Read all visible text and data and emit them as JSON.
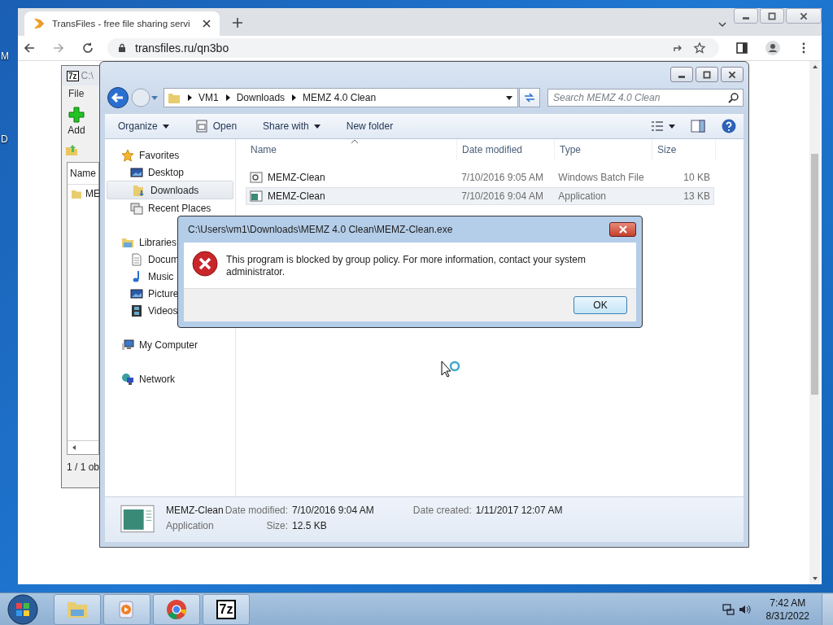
{
  "desktop": {
    "labels": [
      "M",
      "D"
    ]
  },
  "browser": {
    "tab_title": "TransFiles - free file sharing servi",
    "url": "transfiles.ru/qn3bo"
  },
  "archiver": {
    "logo": "7z",
    "title": "C:\\",
    "menu": [
      "File"
    ],
    "toolbar": [
      "Add"
    ],
    "column": "Name",
    "row": "ME",
    "status": "1 / 1 ob"
  },
  "explorer": {
    "breadcrumb": [
      "VM1",
      "Downloads",
      "MEMZ 4.0 Clean"
    ],
    "search": {
      "placeholder": "Search MEMZ 4.0 Clean"
    },
    "toolbar": [
      {
        "label": "Organize",
        "kind": "menu"
      },
      {
        "label": "Open",
        "kind": "open"
      },
      {
        "label": "Share with",
        "kind": "menu"
      },
      {
        "label": "New folder",
        "kind": "plain"
      }
    ],
    "nav": [
      {
        "label": "Favorites",
        "kind": "favorites",
        "selected": false,
        "children": [
          {
            "label": "Desktop",
            "kind": "screen",
            "selected": false
          },
          {
            "label": "Downloads",
            "kind": "folder",
            "selected": true
          },
          {
            "label": "Recent Places",
            "kind": "recent",
            "selected": false
          }
        ]
      },
      {
        "label": "Libraries",
        "kind": "folder",
        "selected": false,
        "children": [
          {
            "label": "Docum",
            "kind": "document",
            "selected": false
          },
          {
            "label": "Music",
            "kind": "music",
            "selected": false
          },
          {
            "label": "Picture",
            "kind": "screen",
            "selected": false
          },
          {
            "label": "Videos",
            "kind": "film",
            "selected": false
          }
        ]
      },
      {
        "label": "My Computer",
        "kind": "computer",
        "selected": false
      },
      {
        "label": "Network",
        "kind": "network",
        "selected": false
      }
    ],
    "columns": [
      "Name",
      "Date modified",
      "Type",
      "Size"
    ],
    "files": [
      {
        "name": "MEMZ-Clean",
        "date": "7/10/2016 9:05 AM",
        "type": "Windows Batch File",
        "size": "10 KB",
        "kind": "batch",
        "selected": false
      },
      {
        "name": "MEMZ-Clean",
        "date": "7/10/2016 9:04 AM",
        "type": "Application",
        "size": "13 KB",
        "kind": "application",
        "selected": true
      }
    ],
    "details": {
      "name": "MEMZ-Clean",
      "type": "Application",
      "modified_label": "Date modified:",
      "modified": "7/10/2016 9:04 AM",
      "created_label": "Date created:",
      "created": "1/11/2017 12:07 AM",
      "size_label": "Size:",
      "size": "12.5 KB"
    }
  },
  "dialog": {
    "title": "C:\\Users\\vm1\\Downloads\\MEMZ 4.0 Clean\\MEMZ-Clean.exe",
    "message": "This program is blocked by group policy. For more information, contact your system administrator.",
    "button": "OK"
  },
  "taskbar": {
    "apps": [
      {
        "kind": "folder"
      },
      {
        "kind": "media"
      },
      {
        "kind": "chrome"
      },
      {
        "kind": "archive",
        "label": "7z"
      }
    ],
    "time": "7:42 AM",
    "date": "8/31/2022"
  }
}
